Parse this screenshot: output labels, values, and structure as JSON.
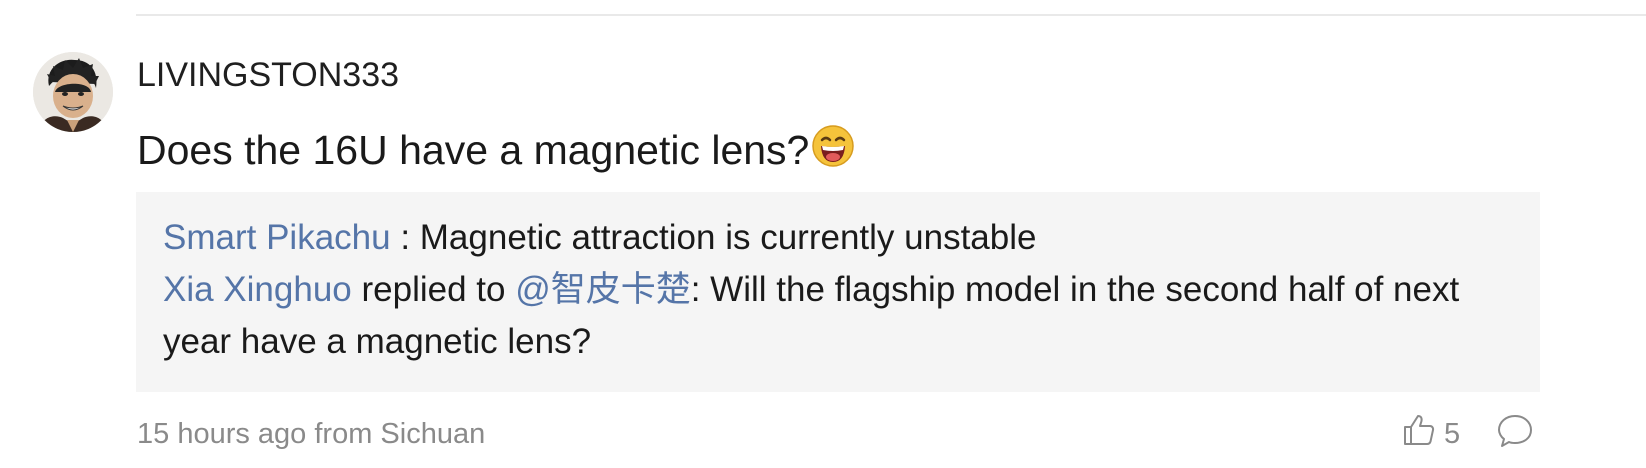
{
  "comment": {
    "username": "LIVINGSTON333",
    "text": "Does the 16U have a magnetic lens?",
    "emoji_icon": "laughing-emoji",
    "meta": "15 hours ago from Sichuan",
    "like_count": "5"
  },
  "replies": [
    {
      "author": "Smart Pikachu",
      "separator": " : ",
      "text": "Magnetic attraction is currently unstable"
    },
    {
      "author": "Xia Xinghuo",
      "middle": " replied to ",
      "mention": "@智皮卡楚",
      "text": ": Will the flagship model in the second half of next year have a magnetic lens?"
    }
  ],
  "colors": {
    "link": "#5575a8",
    "meta": "#8a8a8a",
    "reply_background": "#f5f5f5"
  }
}
